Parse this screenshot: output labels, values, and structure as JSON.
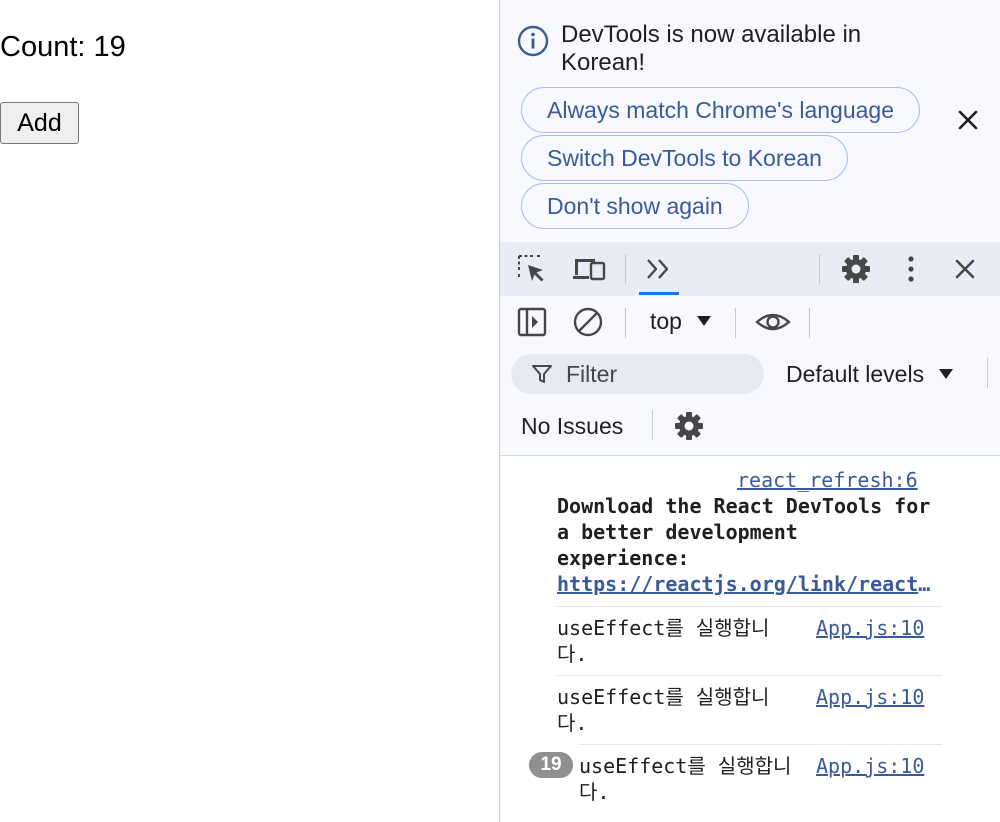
{
  "app": {
    "count_text": "Count: 19",
    "add_label": "Add"
  },
  "devtools": {
    "infobar": {
      "message": "DevTools is now available in Korean!",
      "buttons": [
        "Always match Chrome's language",
        "Switch DevTools to Korean",
        "Don't show again"
      ],
      "icon": "info-icon",
      "close_icon": "close-icon"
    },
    "toolbar": {
      "active_tab": "console",
      "icons": [
        "inspect-element-icon",
        "device-toolbar-icon",
        "console-chevrons-icon",
        "settings-icon",
        "more-options-icon",
        "close-devtools-icon"
      ]
    },
    "console_toolbar": {
      "context": "top",
      "filter_placeholder": "Filter",
      "levels": "Default levels",
      "issues": "No Issues"
    },
    "messages": {
      "react": {
        "source": "react_refresh:6",
        "text": "Download the React DevTools for a better development experience:",
        "link": "https://reactjs.org/link/react-devtools"
      },
      "logs": [
        {
          "text": "useEffect를 실행합니다.",
          "source": "App.js:10",
          "count": ""
        },
        {
          "text": "useEffect를 실행합니다.",
          "source": "App.js:10",
          "count": ""
        },
        {
          "text": "useEffect를 실행합니다.",
          "source": "App.js:10",
          "count": "19"
        }
      ]
    },
    "colors": {
      "accent": "#1a73e8",
      "link": "#3a5b99",
      "badge": "#8f8f8f"
    }
  }
}
